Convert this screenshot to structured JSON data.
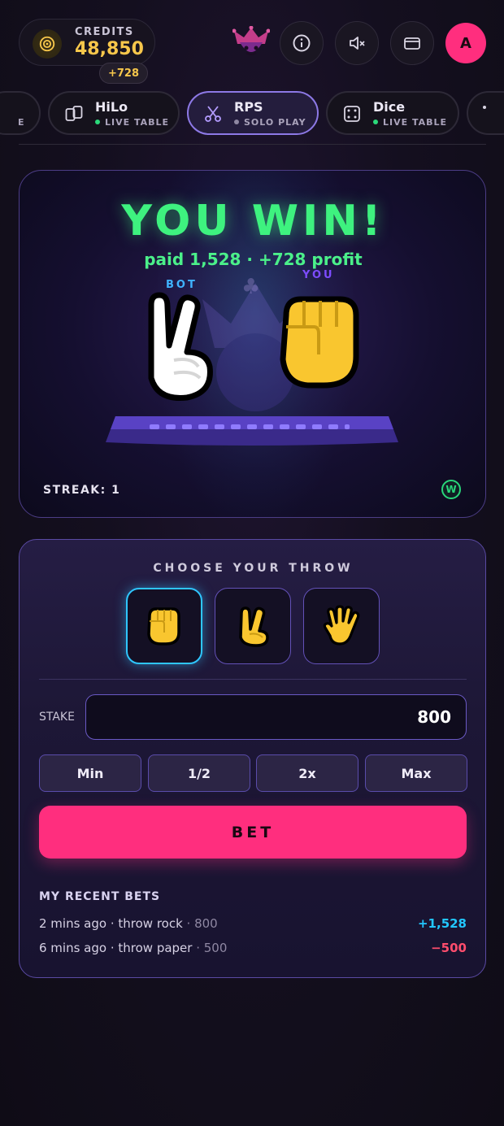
{
  "header": {
    "credits_label": "CREDITS",
    "credits_value": "48,850",
    "credit_delta": "+728",
    "avatar_initial": "A"
  },
  "tabs": [
    {
      "name": "HiLo",
      "sub": "LIVE TABLE",
      "status_color": "#2bd97a"
    },
    {
      "name": "RPS",
      "sub": "SOLO PLAY",
      "status_color": "#8f88a3"
    },
    {
      "name": "Dice",
      "sub": "LIVE TABLE",
      "status_color": "#2bd97a"
    }
  ],
  "tab_partial_left": "E",
  "arena": {
    "result_title": "YOU WIN!",
    "result_sub": "paid 1,528 · +728 profit",
    "bot_label": "BOT",
    "you_label": "YOU",
    "bot_throw": "scissors",
    "you_throw": "rock",
    "streak": "STREAK: 1",
    "badge": "W"
  },
  "controls": {
    "choose_label": "CHOOSE YOUR THROW",
    "throws": [
      "rock",
      "scissors",
      "paper"
    ],
    "selected_throw": "rock",
    "stake_label": "STAKE",
    "stake_value": "800",
    "quick": [
      "Min",
      "1/2",
      "2x",
      "Max"
    ],
    "bet_label": "BET"
  },
  "recent": {
    "title": "MY RECENT BETS",
    "rows": [
      {
        "when": "2 mins ago · throw rock",
        "amount": " · 800",
        "result": "+1,528",
        "result_color": "#22c7ff"
      },
      {
        "when": "6 mins ago · throw paper",
        "amount": " · 500",
        "result": "−500",
        "result_color": "#ff4d6d"
      }
    ]
  },
  "colors": {
    "accent_pink": "#ff2e7e",
    "win_green": "#3ef27f",
    "gold": "#f7c74b",
    "panel_border": "#5a4aa3"
  },
  "icons": [
    "coin-icon",
    "jester-icon",
    "info-icon",
    "mute-icon",
    "wallet-icon",
    "cards-icon",
    "scissors-icon",
    "dice-icon",
    "club-icon"
  ]
}
